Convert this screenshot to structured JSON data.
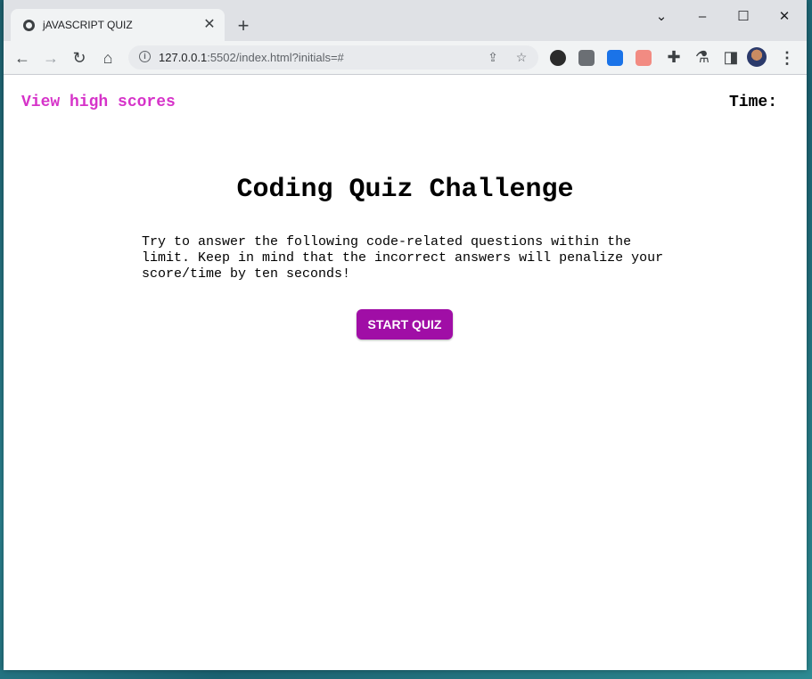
{
  "browser": {
    "tab_title": "jAVASCRIPT QUIZ",
    "tab_close": "✕",
    "new_tab": "+",
    "url_host": "127.0.0.1",
    "url_rest": ":5502/index.html?initials=#",
    "icons": [
      "globe-icon",
      "close-icon",
      "plus-icon",
      "chevron-down-icon",
      "minimize-icon",
      "maximize-icon",
      "close-window-icon",
      "back-icon",
      "forward-icon",
      "reload-icon",
      "home-icon",
      "info-icon",
      "share-icon",
      "star-icon",
      "puzzle-icon",
      "flask-icon",
      "sidebar-icon",
      "kebab-menu-icon"
    ]
  },
  "page": {
    "high_scores_link": "View high scores",
    "timer_label": "Time:",
    "heading": "Coding Quiz Challenge",
    "intro": "Try to answer the following code-related questions within the limit. Keep in mind that the incorrect answers will penalize your score/time by ten seconds!",
    "start_button": "START QUIZ"
  },
  "colors": {
    "link": "#d633c9",
    "button": "#a00ea6"
  }
}
